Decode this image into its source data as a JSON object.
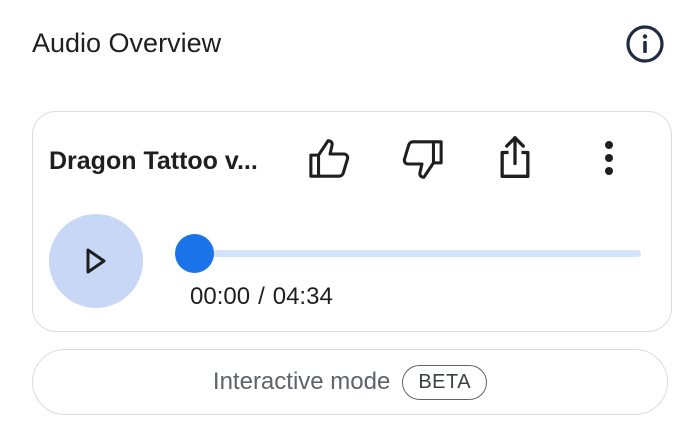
{
  "header": {
    "title": "Audio Overview",
    "info_icon": "info-icon"
  },
  "player": {
    "title": "Dragon Tattoo v...",
    "icons": {
      "like": "thumbs-up-icon",
      "dislike": "thumbs-down-icon",
      "share": "share-icon",
      "more": "more-vert-icon",
      "play": "play-icon"
    },
    "progress": 0,
    "current_time": "00:00",
    "separator": "/",
    "duration": "04:34"
  },
  "interactive_mode": {
    "label": "Interactive mode",
    "badge": "BETA"
  },
  "colors": {
    "accent": "#1a73e8",
    "play_bg": "#c8d7f5",
    "track_bg": "#d3e3fd",
    "border": "#dadce0"
  }
}
